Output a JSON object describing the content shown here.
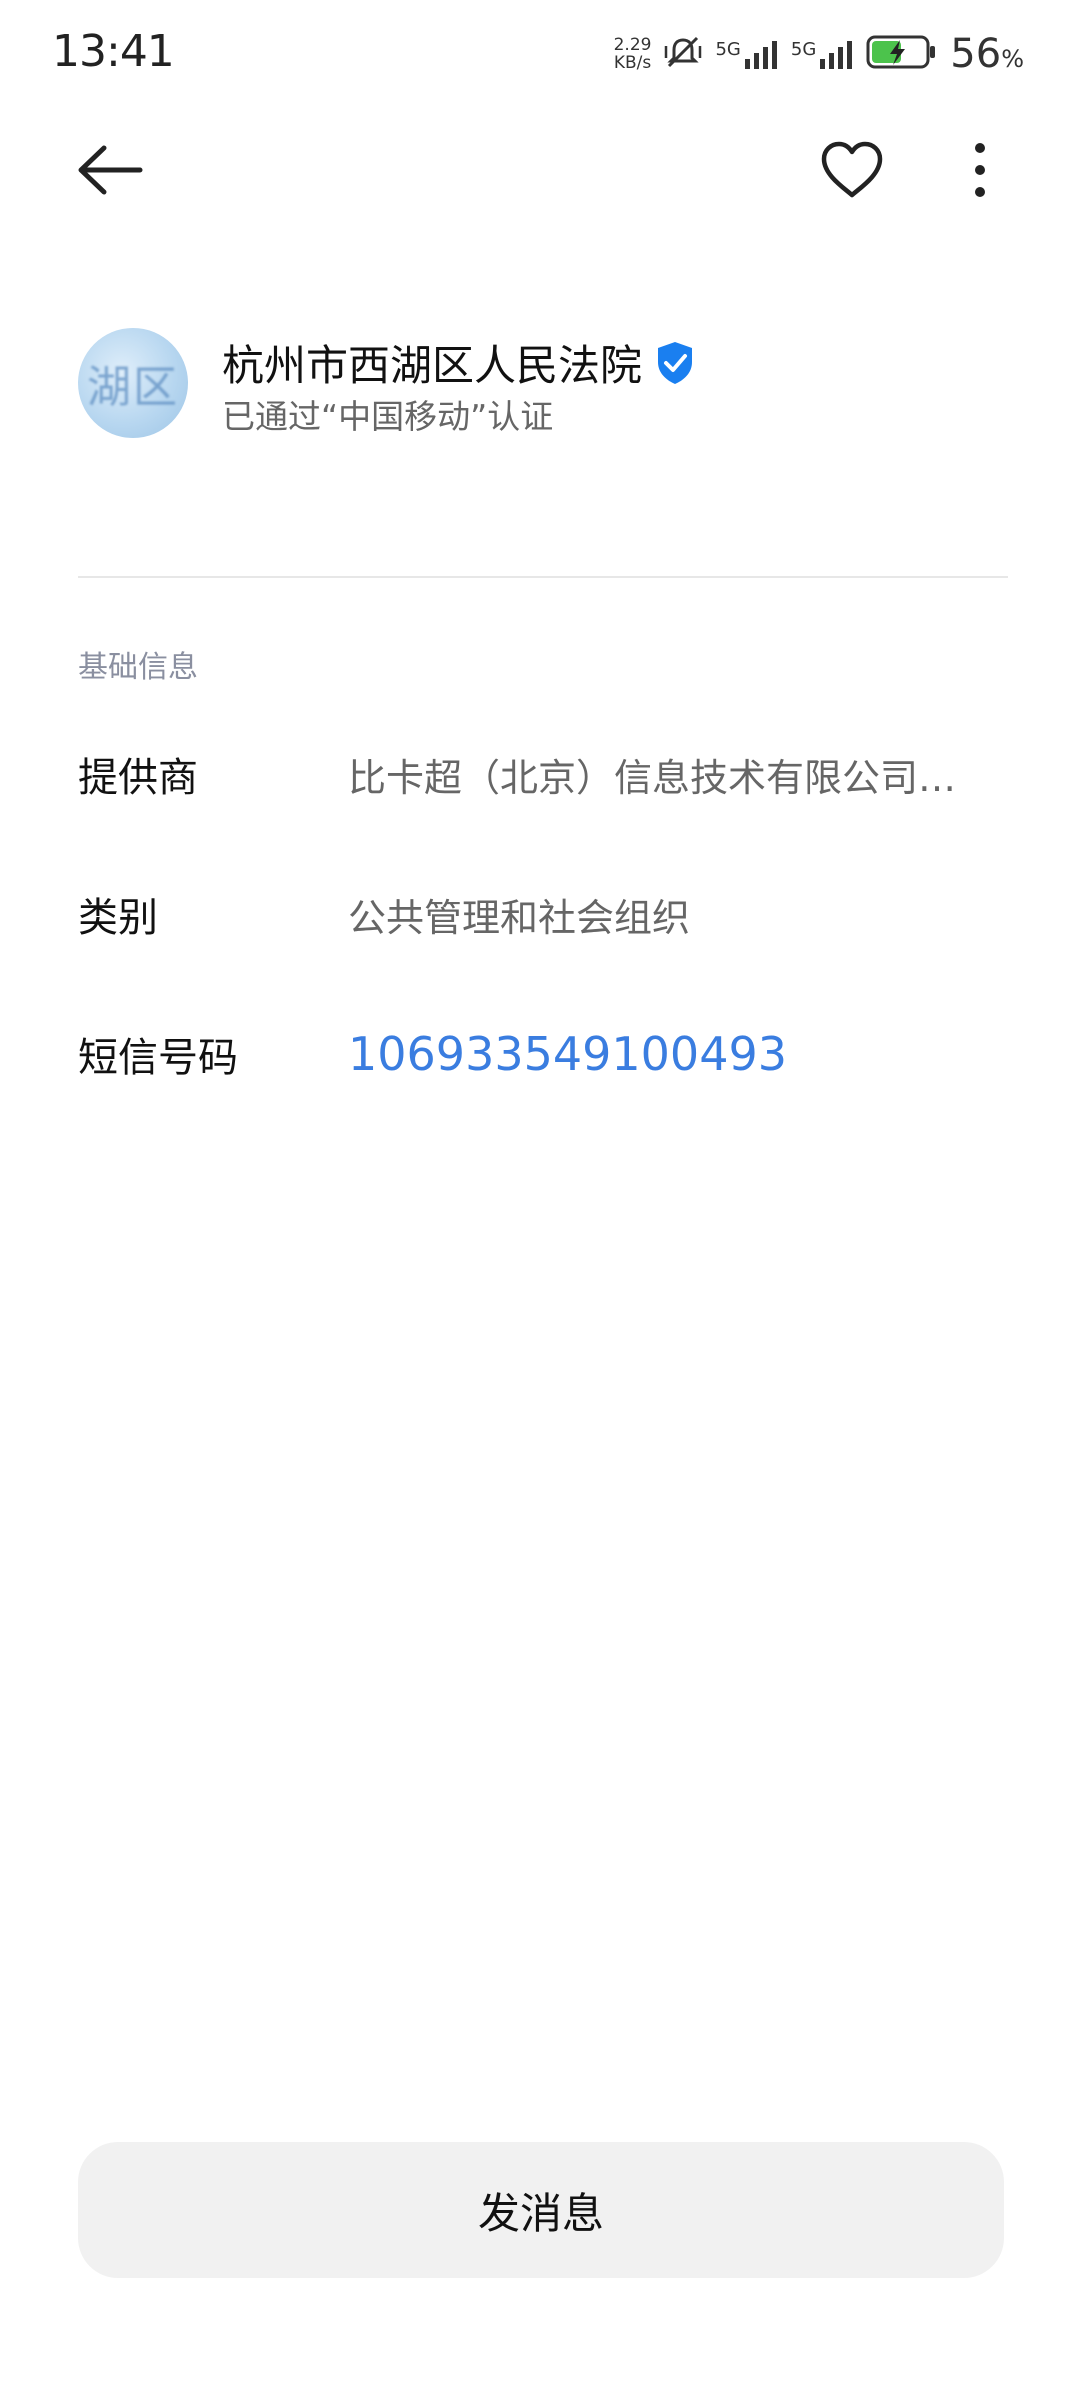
{
  "status_bar": {
    "time": "13:41",
    "net_speed_value": "2.29",
    "net_speed_unit": "KB/s",
    "sim1_label": "5G",
    "sim2_label": "5G",
    "battery_percent": "56",
    "battery_percent_unit": "%",
    "battery_level": 0.56,
    "icons": [
      "vibrate-muted-icon",
      "signal-icon",
      "signal-icon",
      "battery-charging-icon"
    ]
  },
  "nav": {
    "icons": [
      "back-arrow-icon",
      "heart-icon",
      "more-vertical-icon"
    ]
  },
  "profile": {
    "avatar_text": "湖区",
    "name": "杭州市西湖区人民法院",
    "verification_text": "已通过“中国移动”认证",
    "badge_icon": "verified-shield-icon",
    "badge_color": "#1a7ff0"
  },
  "basic_info": {
    "section_title": "基础信息",
    "rows": [
      {
        "label": "提供商",
        "value": "比卡超（北京）信息技术有限公司…"
      },
      {
        "label": "类别",
        "value": "公共管理和社会组织"
      },
      {
        "label": "短信号码",
        "value": "106933549100493"
      }
    ],
    "link_color": "#3a7de0"
  },
  "actions": {
    "send_message_label": "发消息"
  }
}
